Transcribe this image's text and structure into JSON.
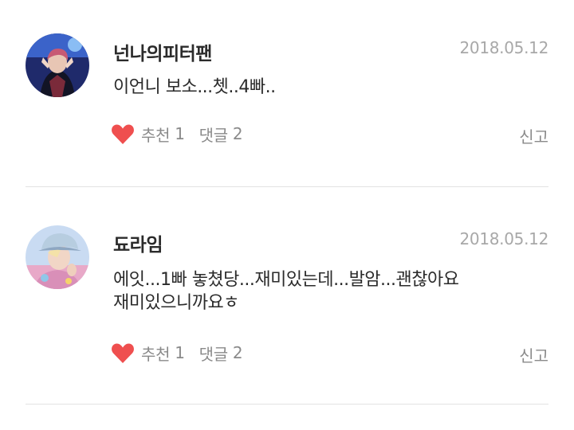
{
  "comments": [
    {
      "username": "넌나의피터팬",
      "date": "2018.05.12",
      "text": "이언니 보소...쳇..4빠..",
      "recommend_label": "추천",
      "recommend_count": "1",
      "reply_label": "댓글",
      "reply_count": "2",
      "report_label": "신고",
      "avatar_icon": "profile-photo-dark-stage",
      "heart_color": "#ef4f4f"
    },
    {
      "username": "됴라임",
      "date": "2018.05.12",
      "text_line1": "에잇...1빠 놓쳤당...재미있는데...발암...괜찮아요",
      "text_line2": "재미있으니까요ㅎ",
      "recommend_label": "추천",
      "recommend_count": "1",
      "reply_label": "댓글",
      "reply_count": "2",
      "report_label": "신고",
      "avatar_icon": "profile-photo-blue-hat",
      "heart_color": "#ef4f4f"
    }
  ]
}
